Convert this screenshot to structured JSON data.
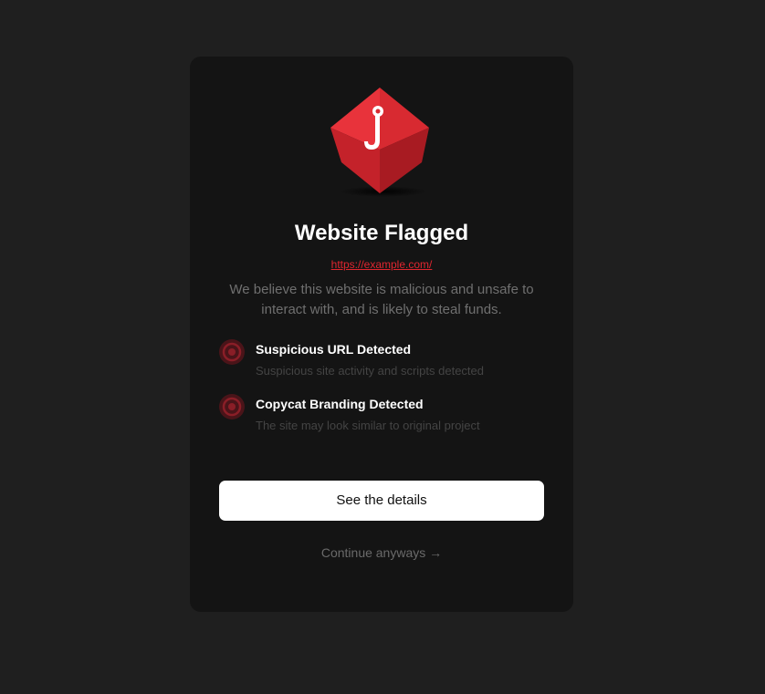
{
  "dialog": {
    "logo_icon": "fishing-hook-cube-icon",
    "title": "Website Flagged",
    "url": "https://example.com/",
    "description": "We believe this website is malicious and unsafe to interact with, and is likely to steal funds."
  },
  "reasons": [
    {
      "icon": "target-icon",
      "title": "Suspicious URL Detected",
      "subtitle": "Suspicious site activity and scripts detected"
    },
    {
      "icon": "target-icon",
      "title": "Copycat Branding Detected",
      "subtitle": "The site may look similar to original project"
    }
  ],
  "actions": {
    "details_label": "See the details",
    "continue_label": "Continue anyways →"
  },
  "colors": {
    "page_background": "#1f1f1f",
    "card_background": "#141414",
    "accent_red": "#e0262f",
    "button_background": "#ffffff"
  }
}
